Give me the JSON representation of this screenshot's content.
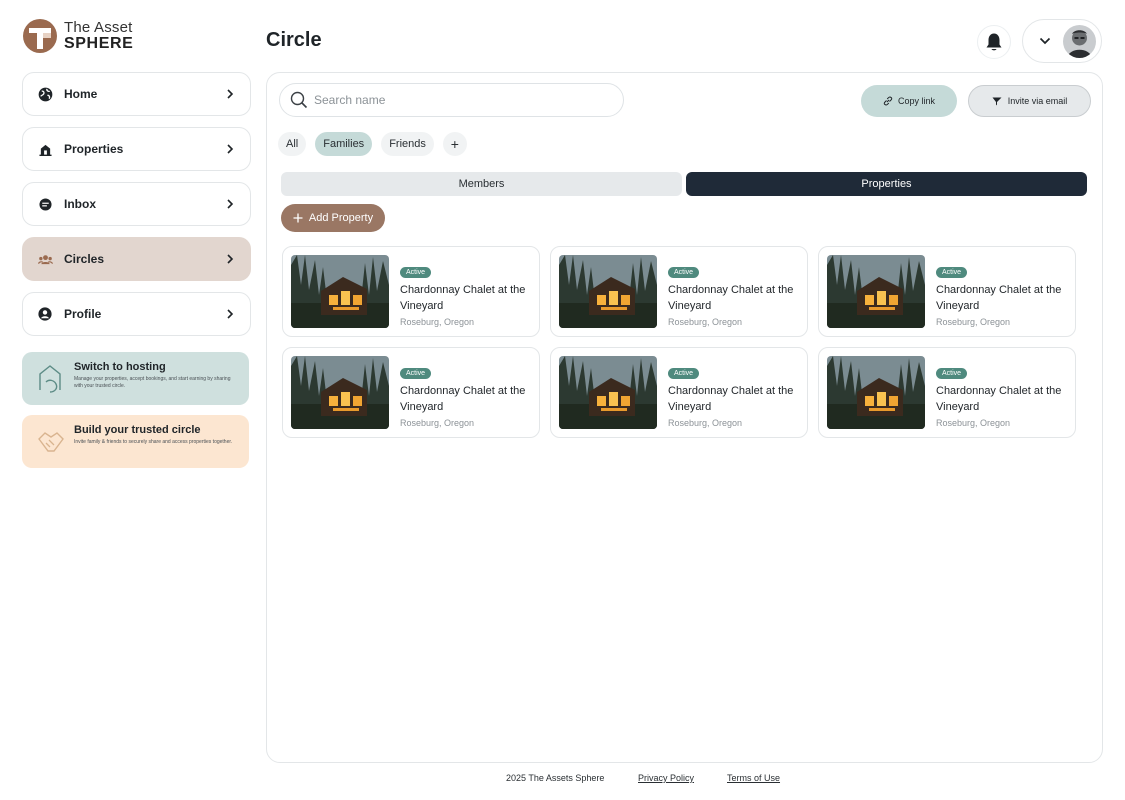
{
  "brand": {
    "line1": "The Asset",
    "line2": "SPHERE"
  },
  "sidebar": {
    "items": [
      {
        "label": "Home",
        "icon": "globe-icon"
      },
      {
        "label": "Properties",
        "icon": "building-icon"
      },
      {
        "label": "Inbox",
        "icon": "message-icon"
      },
      {
        "label": "Circles",
        "icon": "people-icon",
        "active": true
      },
      {
        "label": "Profile",
        "icon": "user-icon"
      }
    ],
    "promos": [
      {
        "title": "Switch to hosting",
        "desc": "Manage your properties, accept bookings, and start earning by sharing with your trusted circle."
      },
      {
        "title": "Build your trusted circle",
        "desc": "Invite family & friends to securely share and access properties together."
      }
    ]
  },
  "header": {
    "title": "Circle"
  },
  "search": {
    "placeholder": "Search name"
  },
  "actions": {
    "copy_link": "Copy link",
    "invite": "Invite via email"
  },
  "filters": [
    {
      "label": "All"
    },
    {
      "label": "Families",
      "selected": true
    },
    {
      "label": "Friends"
    }
  ],
  "filter_add": "+",
  "tabs": {
    "members": "Members",
    "properties": "Properties",
    "selected": "properties"
  },
  "add_property": "Add Property",
  "properties": [
    {
      "status": "Active",
      "title": "Chardonnay Chalet at the Vineyard",
      "location": "Roseburg, Oregon"
    },
    {
      "status": "Active",
      "title": "Chardonnay Chalet at the Vineyard",
      "location": "Roseburg, Oregon"
    },
    {
      "status": "Active",
      "title": "Chardonnay Chalet at the Vineyard",
      "location": "Roseburg, Oregon"
    },
    {
      "status": "Active",
      "title": "Chardonnay Chalet at the Vineyard",
      "location": "Roseburg, Oregon"
    },
    {
      "status": "Active",
      "title": "Chardonnay Chalet at the Vineyard",
      "location": "Roseburg, Oregon"
    },
    {
      "status": "Active",
      "title": "Chardonnay Chalet at the Vineyard",
      "location": "Roseburg, Oregon"
    }
  ],
  "footer": {
    "copyright": "2025 The Assets Sphere",
    "privacy": "Privacy Policy",
    "terms": "Terms of Use"
  },
  "colors": {
    "active_nav": "#e2d6cf",
    "accent_teal": "#c5dad8",
    "badge": "#4f8a7e",
    "add_button": "#9a7764",
    "tab_selected": "#1f2a38",
    "promo_hosting": "#cfe0de",
    "promo_circle": "#fce6d1",
    "logo_brown": "#9a6a4f"
  }
}
